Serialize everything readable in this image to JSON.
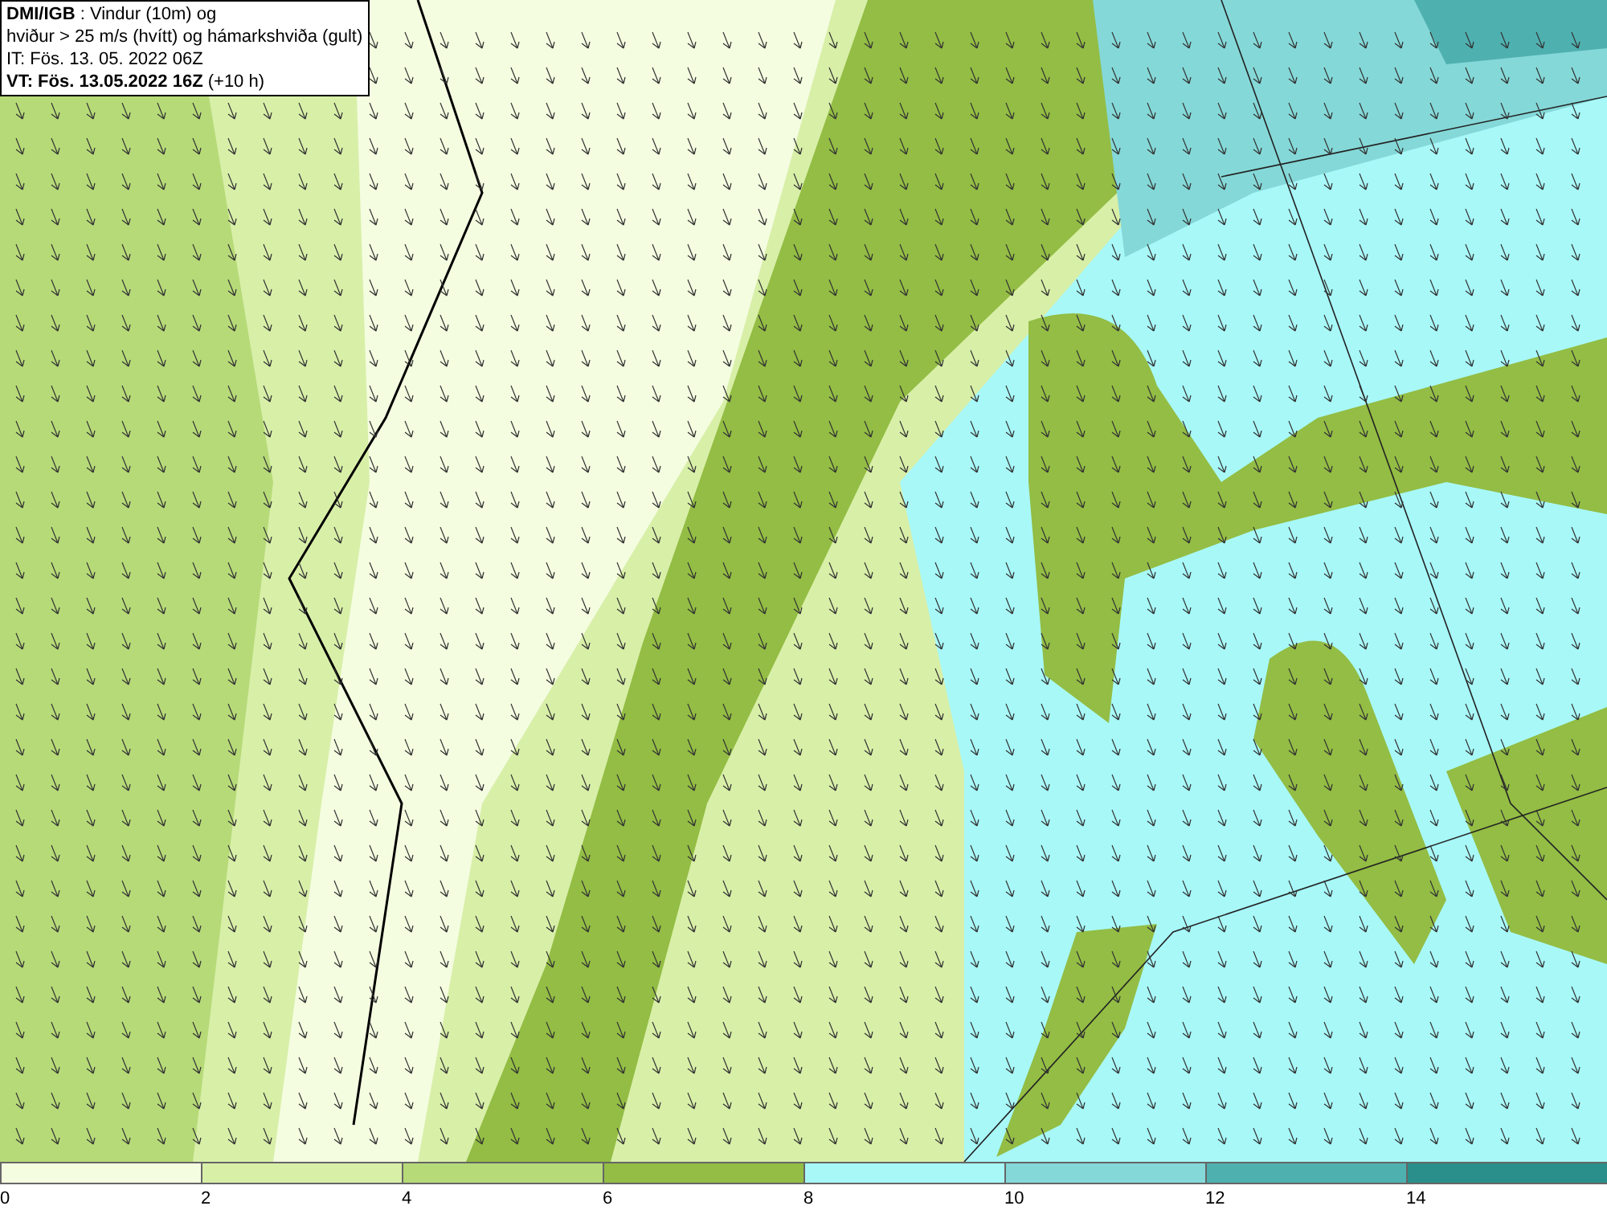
{
  "info_box": {
    "lines": [
      "**DMI/IGB** : Vindur (10m) og",
      "hviður > 25 m/s (hvítt) og hámarkshviða (gult)",
      "IT: Fös. 13. 05. 2022 06Z",
      "**VT: Fös. 13.05.2022 16Z** (+10 h)"
    ]
  },
  "legend": [
    {
      "label": "0",
      "color": "#f4fde0"
    },
    {
      "label": "2",
      "color": "#d8efa8"
    },
    {
      "label": "4",
      "color": "#b6da78"
    },
    {
      "label": "6",
      "color": "#93bd44"
    },
    {
      "label": "8",
      "color": "#a8f8f8"
    },
    {
      "label": "10",
      "color": "#85d8d8"
    },
    {
      "label": "12",
      "color": "#4fb0b0"
    },
    {
      "label": "14",
      "color": "#2a8f8a"
    }
  ]
}
